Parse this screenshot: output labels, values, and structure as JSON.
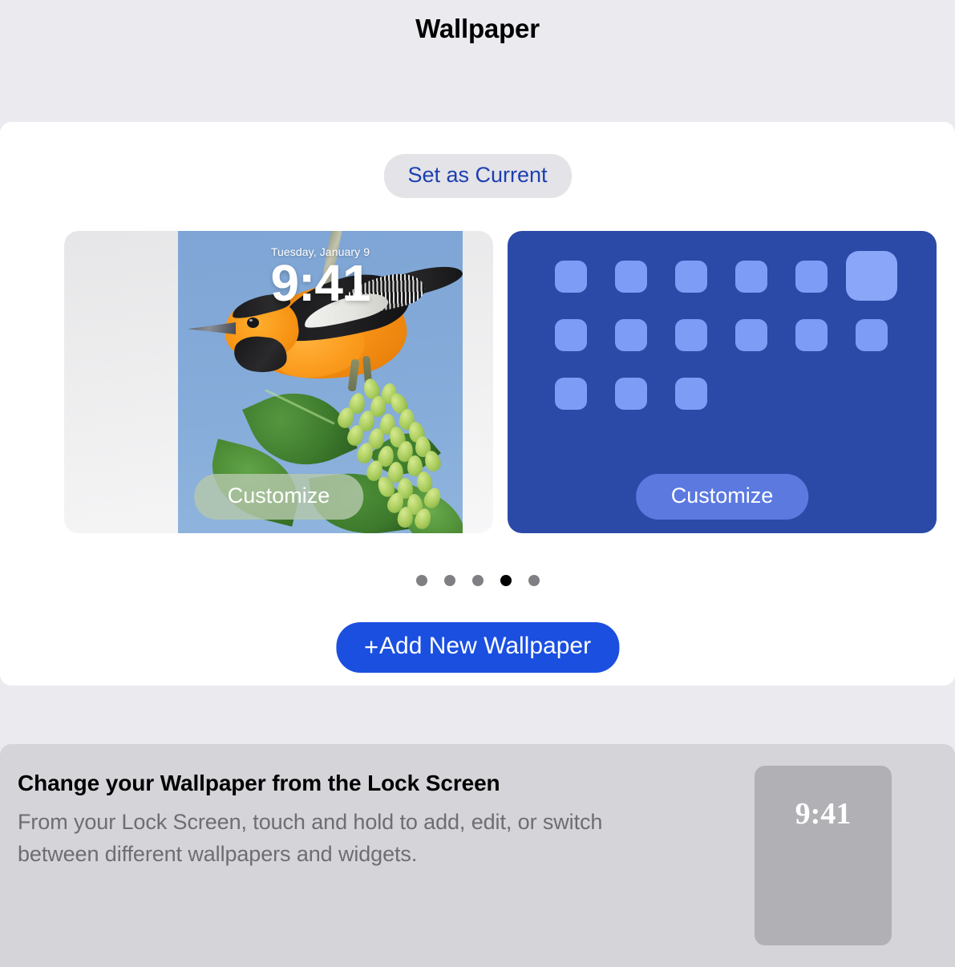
{
  "header": {
    "title": "Wallpaper"
  },
  "main": {
    "set_as_current_label": "Set as Current",
    "add_new_wallpaper_label": "Add New Wallpaper",
    "add_new_wallpaper_plus": "+",
    "lock_preview": {
      "date": "Tuesday, January 9",
      "time": "9:41",
      "customize_label": "Customize"
    },
    "home_preview": {
      "customize_label": "Customize",
      "background_color": "#2b4aa8",
      "icon_color": "#7d9cf5",
      "grid": [
        [
          {
            "size": "small"
          },
          {
            "size": "small"
          },
          {
            "size": "small"
          },
          {
            "size": "small"
          },
          {
            "size": "small"
          },
          {
            "size": "large"
          }
        ],
        [
          {
            "size": "small"
          },
          {
            "size": "small"
          },
          {
            "size": "small"
          },
          {
            "size": "small"
          },
          {
            "size": "small"
          },
          {
            "size": "small"
          }
        ],
        [
          {
            "size": "small"
          },
          {
            "size": "small"
          },
          {
            "size": "small"
          }
        ]
      ]
    },
    "page_dots": {
      "count": 5,
      "active_index": 3
    }
  },
  "info_card": {
    "heading": "Change your Wallpaper from the Lock Screen",
    "body": "From your Lock Screen, touch and hold to add, edit, or switch between different wallpapers and widgets.",
    "thumbnail_time": "9:41"
  },
  "colors": {
    "page_background": "#eaeaef",
    "card_background": "#ffffff",
    "accent_blue": "#1a4fe0",
    "link_blue": "#1d3fb0",
    "info_card_background": "#d4d4d9",
    "thumbnail_background": "#b0b0b5",
    "dot_inactive": "#808084",
    "dot_active": "#000000"
  }
}
